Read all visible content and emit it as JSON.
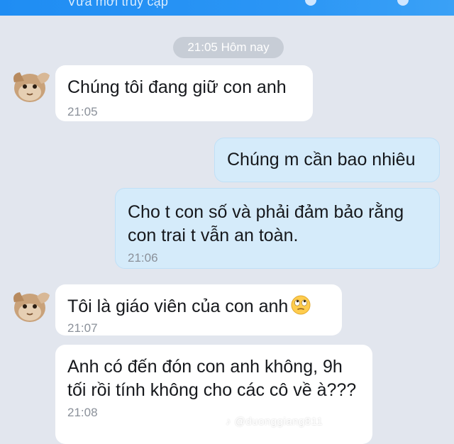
{
  "header": {
    "status_text": "Vừa mới truy cập"
  },
  "conversation": {
    "time_divider": "21:05 Hôm nay",
    "messages": [
      {
        "direction": "incoming",
        "text": "Chúng tôi đang giữ con anh",
        "time": "21:05"
      },
      {
        "direction": "outgoing",
        "text": "Chúng m cần bao nhiêu",
        "time": ""
      },
      {
        "direction": "outgoing",
        "text": "Cho t con số và phải đảm bảo rằng con trai t vẫn an toàn.",
        "time": "21:06"
      },
      {
        "direction": "incoming",
        "text": "Tôi là giáo viên của con anh",
        "emoji": "rolling-eyes-emoji",
        "time": "21:07"
      },
      {
        "direction": "incoming",
        "text": "Anh có đến đón con anh không, 9h tối rồi tính không cho các cô về à???",
        "time": "21:08"
      }
    ]
  },
  "colors": {
    "header_blue": "#2a95f5",
    "background": "#e2e6ee",
    "incoming_bubble": "#ffffff",
    "outgoing_bubble": "#d5ebfa",
    "time_pill": "#c7cdd6"
  },
  "watermark": {
    "text": "♪ @duonggiang811"
  }
}
